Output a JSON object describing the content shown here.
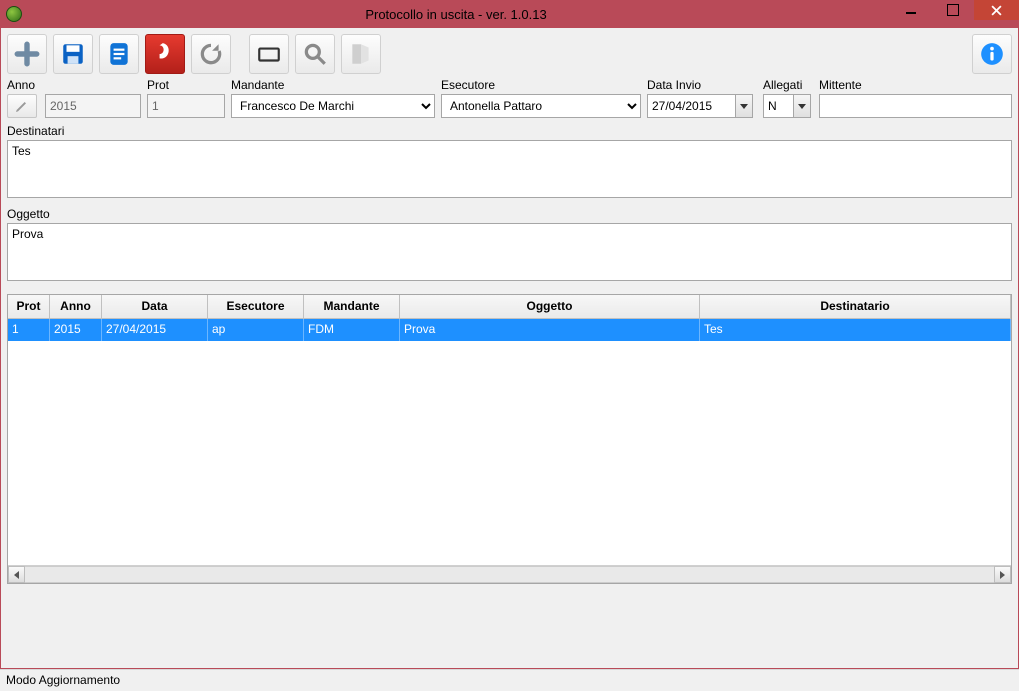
{
  "window": {
    "title": "Protocollo in uscita - ver. 1.0.13"
  },
  "toolbar": {
    "new": "new",
    "save": "save",
    "savealt": "savealt",
    "pdf": "pdf",
    "refresh": "refresh",
    "card": "card",
    "search": "search",
    "exit": "exit",
    "info": "info"
  },
  "form": {
    "anno_label": "Anno",
    "anno_value": "2015",
    "prot_label": "Prot",
    "prot_value": "1",
    "mandante_label": "Mandante",
    "mandante_value": "Francesco De Marchi",
    "esecutore_label": "Esecutore",
    "esecutore_value": "Antonella Pattaro",
    "data_invio_label": "Data Invio",
    "data_invio_value": "27/04/2015",
    "allegati_label": "Allegati",
    "allegati_value": "N",
    "mittente_label": "Mittente",
    "mittente_value": "",
    "destinatari_label": "Destinatari",
    "destinatari_value": "Tes",
    "oggetto_label": "Oggetto",
    "oggetto_value": "Prova"
  },
  "grid": {
    "headers": {
      "prot": "Prot",
      "anno": "Anno",
      "data": "Data",
      "esecutore": "Esecutore",
      "mandante": "Mandante",
      "oggetto": "Oggetto",
      "destinatario": "Destinatario"
    },
    "rows": [
      {
        "prot": "1",
        "anno": "2015",
        "data": "27/04/2015",
        "esecutore": "ap",
        "mandante": "FDM",
        "oggetto": "Prova",
        "destinatario": "Tes"
      }
    ]
  },
  "status": "Modo Aggiornamento"
}
